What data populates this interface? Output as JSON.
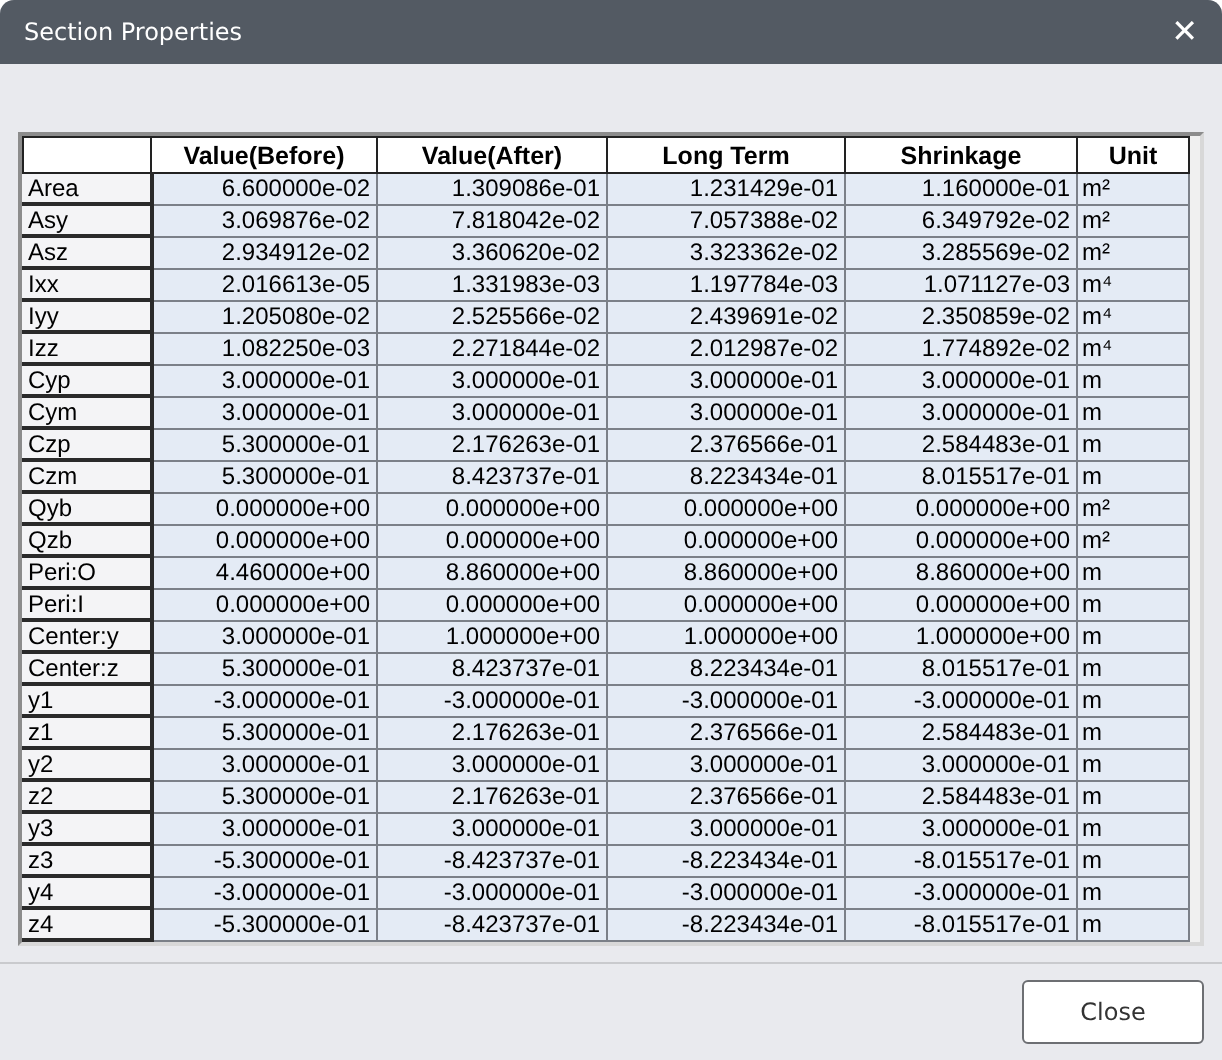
{
  "window": {
    "title": "Section Properties",
    "close_glyph": "✕"
  },
  "table": {
    "columns": [
      "Value(Before)",
      "Value(After)",
      "Long Term",
      "Shrinkage",
      "Unit"
    ],
    "rows": [
      {
        "label": "Area",
        "values": [
          "6.600000e-02",
          "1.309086e-01",
          "1.231429e-01",
          "1.160000e-01",
          "m²"
        ]
      },
      {
        "label": "Asy",
        "values": [
          "3.069876e-02",
          "7.818042e-02",
          "7.057388e-02",
          "6.349792e-02",
          "m²"
        ]
      },
      {
        "label": "Asz",
        "values": [
          "2.934912e-02",
          "3.360620e-02",
          "3.323362e-02",
          "3.285569e-02",
          "m²"
        ]
      },
      {
        "label": "Ixx",
        "values": [
          "2.016613e-05",
          "1.331983e-03",
          "1.197784e-03",
          "1.071127e-03",
          "m⁴"
        ]
      },
      {
        "label": "Iyy",
        "values": [
          "1.205080e-02",
          "2.525566e-02",
          "2.439691e-02",
          "2.350859e-02",
          "m⁴"
        ]
      },
      {
        "label": "Izz",
        "values": [
          "1.082250e-03",
          "2.271844e-02",
          "2.012987e-02",
          "1.774892e-02",
          "m⁴"
        ]
      },
      {
        "label": "Cyp",
        "values": [
          "3.000000e-01",
          "3.000000e-01",
          "3.000000e-01",
          "3.000000e-01",
          "m"
        ]
      },
      {
        "label": "Cym",
        "values": [
          "3.000000e-01",
          "3.000000e-01",
          "3.000000e-01",
          "3.000000e-01",
          "m"
        ]
      },
      {
        "label": "Czp",
        "values": [
          "5.300000e-01",
          "2.176263e-01",
          "2.376566e-01",
          "2.584483e-01",
          "m"
        ]
      },
      {
        "label": "Czm",
        "values": [
          "5.300000e-01",
          "8.423737e-01",
          "8.223434e-01",
          "8.015517e-01",
          "m"
        ]
      },
      {
        "label": "Qyb",
        "values": [
          "0.000000e+00",
          "0.000000e+00",
          "0.000000e+00",
          "0.000000e+00",
          "m²"
        ]
      },
      {
        "label": "Qzb",
        "values": [
          "0.000000e+00",
          "0.000000e+00",
          "0.000000e+00",
          "0.000000e+00",
          "m²"
        ]
      },
      {
        "label": "Peri:O",
        "values": [
          "4.460000e+00",
          "8.860000e+00",
          "8.860000e+00",
          "8.860000e+00",
          "m"
        ]
      },
      {
        "label": "Peri:I",
        "values": [
          "0.000000e+00",
          "0.000000e+00",
          "0.000000e+00",
          "0.000000e+00",
          "m"
        ]
      },
      {
        "label": "Center:y",
        "values": [
          "3.000000e-01",
          "1.000000e+00",
          "1.000000e+00",
          "1.000000e+00",
          "m"
        ]
      },
      {
        "label": "Center:z",
        "values": [
          "5.300000e-01",
          "8.423737e-01",
          "8.223434e-01",
          "8.015517e-01",
          "m"
        ]
      },
      {
        "label": "y1",
        "values": [
          "-3.000000e-01",
          "-3.000000e-01",
          "-3.000000e-01",
          "-3.000000e-01",
          "m"
        ]
      },
      {
        "label": "z1",
        "values": [
          "5.300000e-01",
          "2.176263e-01",
          "2.376566e-01",
          "2.584483e-01",
          "m"
        ]
      },
      {
        "label": "y2",
        "values": [
          "3.000000e-01",
          "3.000000e-01",
          "3.000000e-01",
          "3.000000e-01",
          "m"
        ]
      },
      {
        "label": "z2",
        "values": [
          "5.300000e-01",
          "2.176263e-01",
          "2.376566e-01",
          "2.584483e-01",
          "m"
        ]
      },
      {
        "label": "y3",
        "values": [
          "3.000000e-01",
          "3.000000e-01",
          "3.000000e-01",
          "3.000000e-01",
          "m"
        ]
      },
      {
        "label": "z3",
        "values": [
          "-5.300000e-01",
          "-8.423737e-01",
          "-8.223434e-01",
          "-8.015517e-01",
          "m"
        ]
      },
      {
        "label": "y4",
        "values": [
          "-3.000000e-01",
          "-3.000000e-01",
          "-3.000000e-01",
          "-3.000000e-01",
          "m"
        ]
      },
      {
        "label": "z4",
        "values": [
          "-5.300000e-01",
          "-8.423737e-01",
          "-8.223434e-01",
          "-8.015517e-01",
          "m"
        ]
      }
    ]
  },
  "buttons": [
    "Close"
  ]
}
